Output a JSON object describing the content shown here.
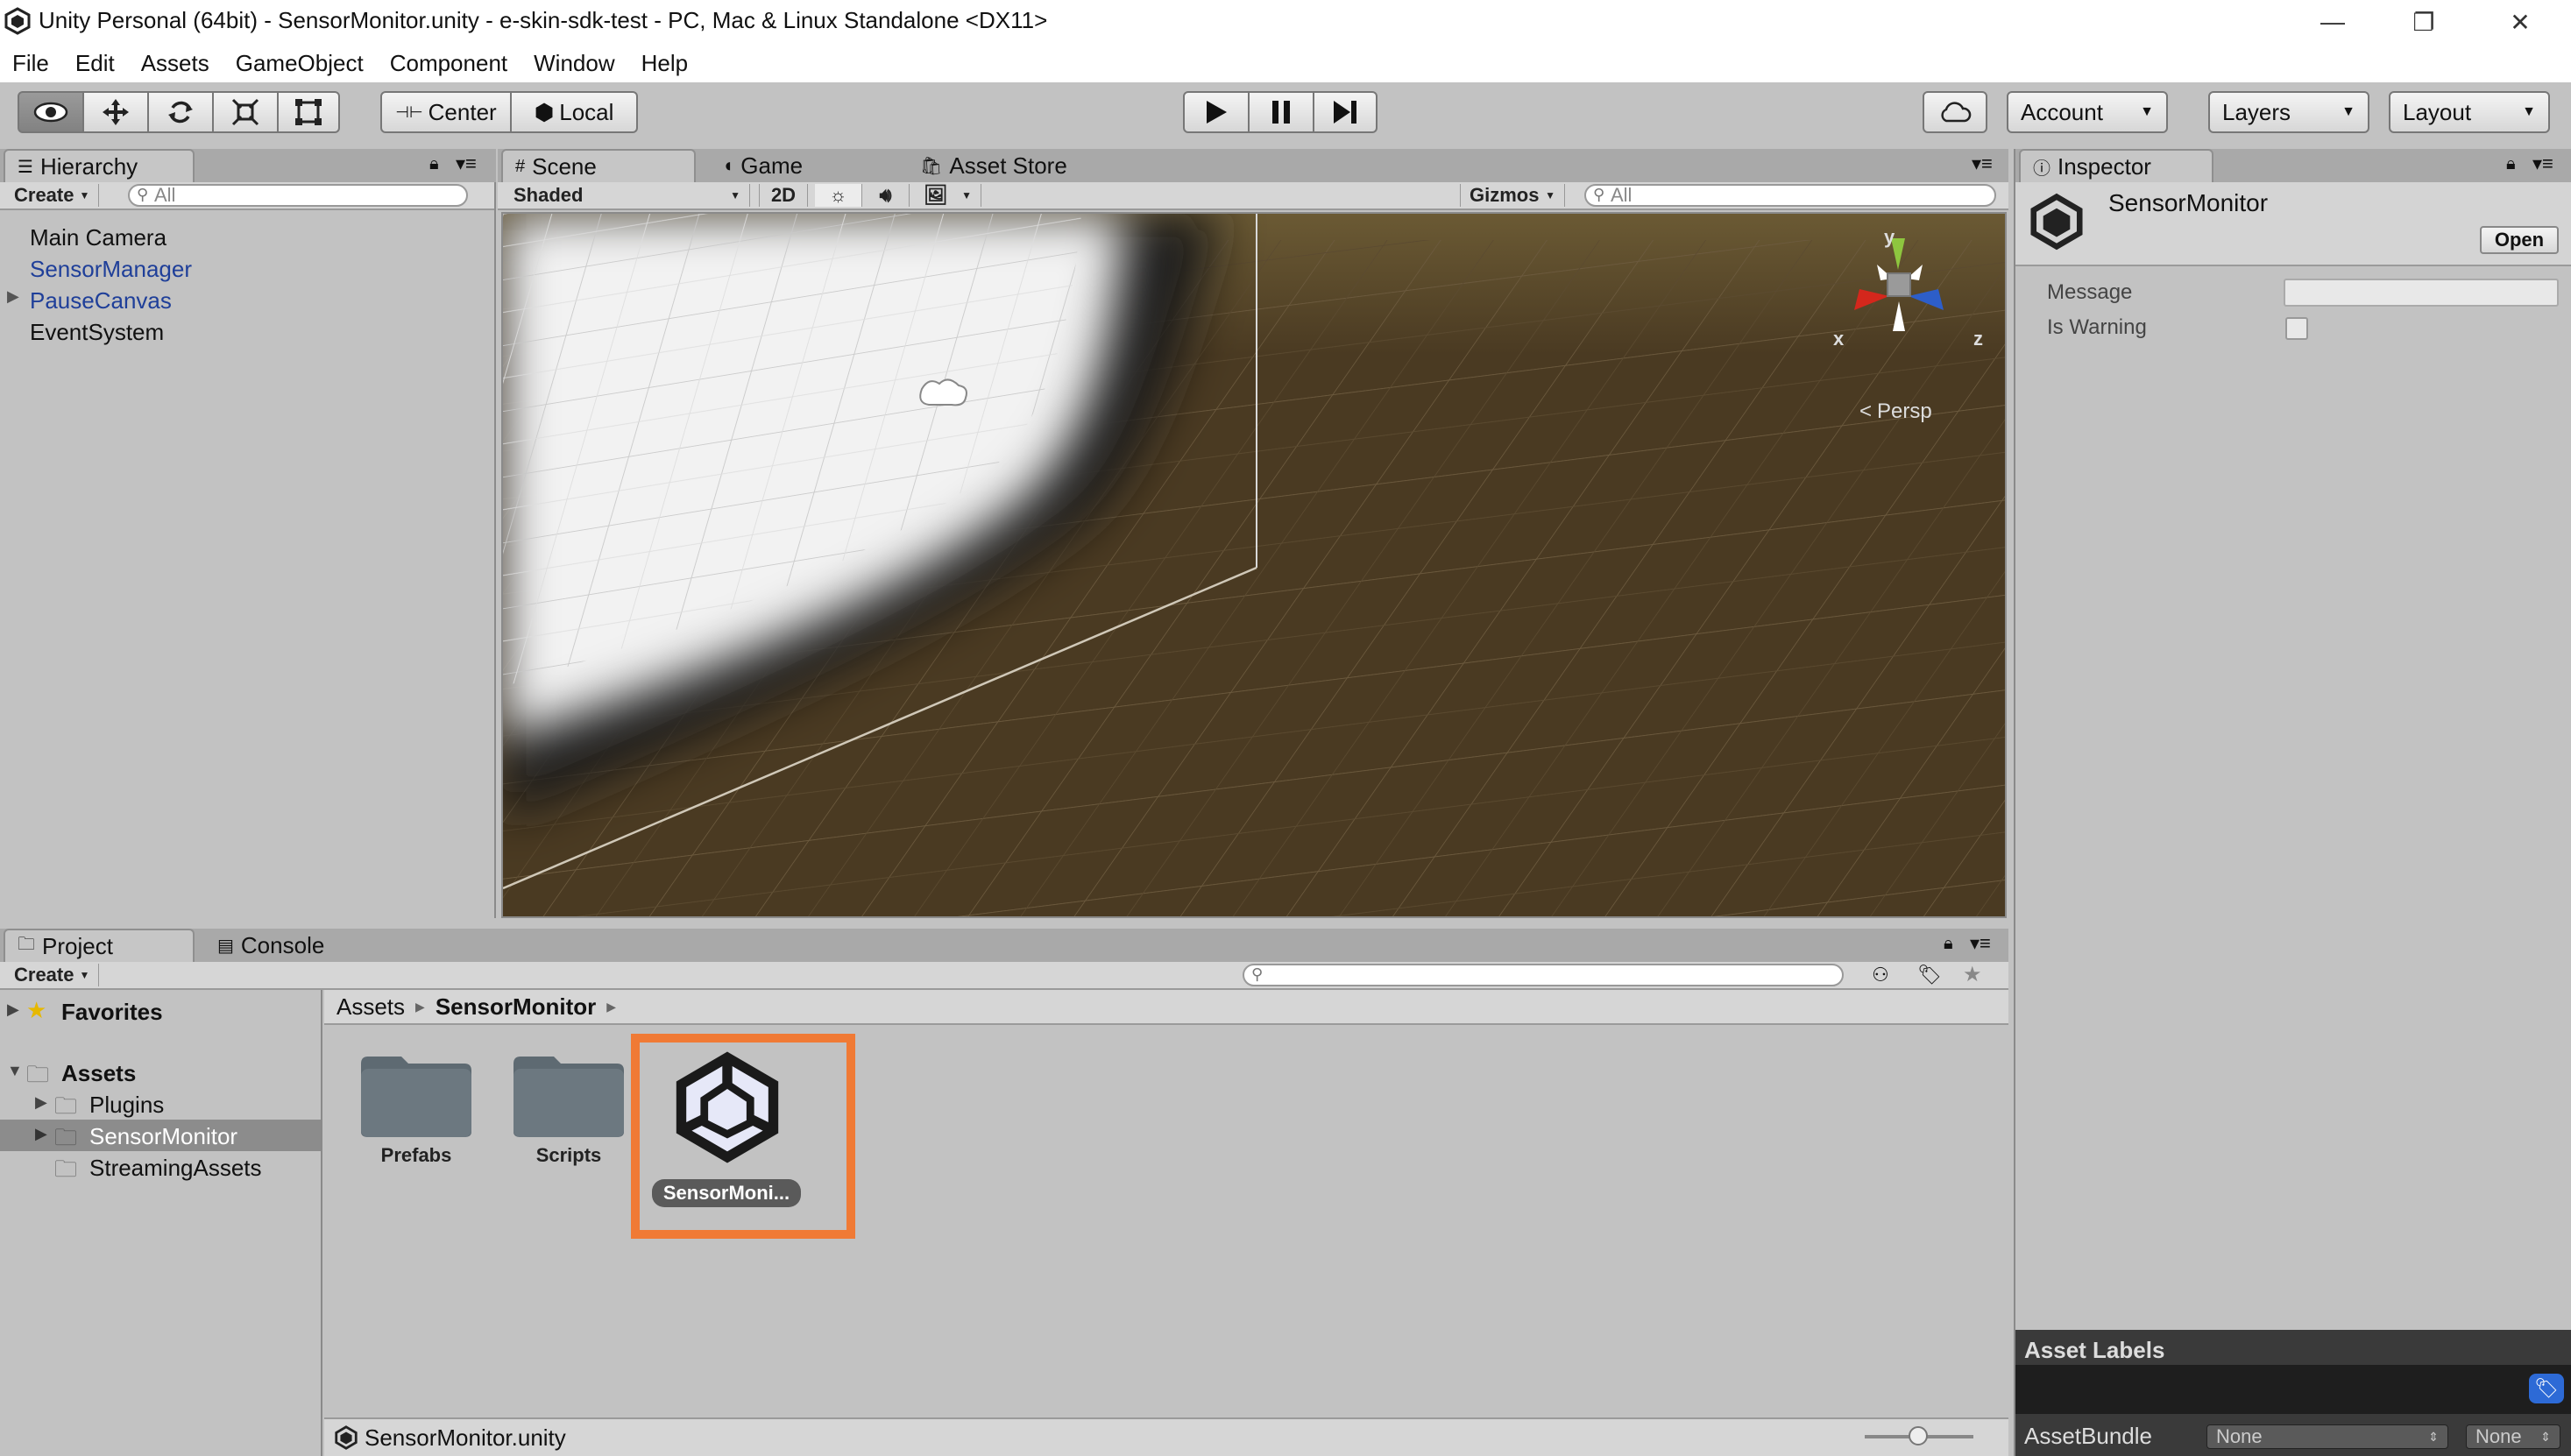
{
  "window": {
    "title": "Unity Personal (64bit) - SensorMonitor.unity - e-skin-sdk-test - PC, Mac & Linux Standalone <DX11>",
    "minimize": "—",
    "restore": "❐",
    "close": "✕"
  },
  "menu": [
    "File",
    "Edit",
    "Assets",
    "GameObject",
    "Component",
    "Window",
    "Help"
  ],
  "toolbar": {
    "center": "Center",
    "local": "Local",
    "account": "Account",
    "layers": "Layers",
    "layout": "Layout"
  },
  "hierarchy": {
    "tab": "Hierarchy",
    "create": "Create",
    "search_placeholder": "All",
    "items": [
      {
        "label": "Main Camera",
        "color": "#111111"
      },
      {
        "label": "SensorManager",
        "color": "#1f3f99"
      },
      {
        "label": "PauseCanvas",
        "color": "#1f3f99"
      },
      {
        "label": "EventSystem",
        "color": "#111111"
      }
    ]
  },
  "scene": {
    "tabs": [
      "Scene",
      "Game",
      "Asset Store"
    ],
    "shading": "Shaded",
    "mode2d": "2D",
    "gizmos": "Gizmos",
    "search_placeholder": "All",
    "projection": "Persp",
    "axes": {
      "x": "x",
      "y": "y",
      "z": "z"
    }
  },
  "inspector": {
    "tab": "Inspector",
    "object_name": "SensorMonitor",
    "open_button": "Open",
    "fields": [
      {
        "label": "Message",
        "type": "text",
        "value": ""
      },
      {
        "label": "Is Warning",
        "type": "checkbox",
        "checked": false
      }
    ],
    "asset_labels": "Asset Labels",
    "asset_bundle_label": "AssetBundle",
    "asset_bundle_value": "None",
    "asset_bundle_variant": "None"
  },
  "project": {
    "tabs": [
      "Project",
      "Console"
    ],
    "create": "Create",
    "tree": [
      {
        "label": "Favorites",
        "bold": true
      },
      {
        "label": "Assets",
        "bold": true
      },
      {
        "label": "Plugins",
        "bold": false
      },
      {
        "label": "SensorMonitor",
        "bold": false
      },
      {
        "label": "StreamingAssets",
        "bold": false
      }
    ],
    "breadcrumb": [
      "Assets",
      "SensorMonitor"
    ],
    "assets": [
      "Prefabs",
      "Scripts",
      "SensorMoni..."
    ],
    "status": "SensorMonitor.unity",
    "highlight_color": "#f07a35"
  }
}
